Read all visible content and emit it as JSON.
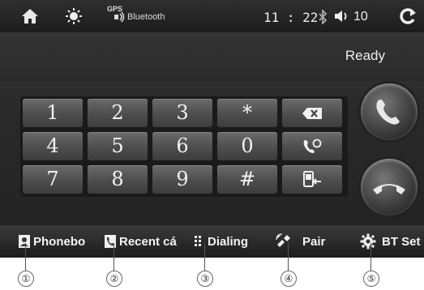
{
  "status_bar": {
    "gps_label": "GPS",
    "bluetooth_label": "Bluetooth",
    "time": "11 : 22",
    "volume": "10"
  },
  "status_text": "Ready",
  "keypad": {
    "keys": [
      "1",
      "2",
      "3",
      "*",
      "4",
      "5",
      "6",
      "0",
      "7",
      "8",
      "9",
      "#"
    ]
  },
  "bottom_tabs": [
    {
      "label": "Phonebo",
      "icon": "phonebook-icon"
    },
    {
      "label": "Recent cá",
      "icon": "recent-calls-icon"
    },
    {
      "label": "Dialing",
      "icon": "dialpad-icon"
    },
    {
      "label": "Pair",
      "icon": "pair-icon"
    },
    {
      "label": "BT Set",
      "icon": "gear-icon"
    }
  ],
  "callouts": [
    "①",
    "②",
    "③",
    "④",
    "⑤"
  ],
  "colors": {
    "screen_bg": "#2a2a2a",
    "key_face": "#5a5a5a",
    "text": "#f2f2f2"
  }
}
